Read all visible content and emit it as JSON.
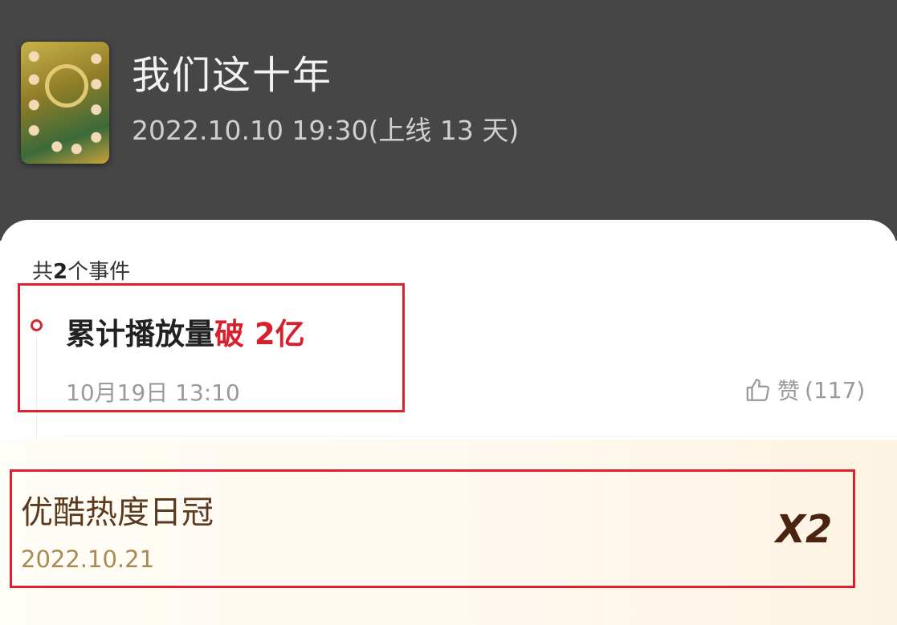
{
  "show": {
    "title": "我们这十年",
    "air_info": "2022.10.10 19:30(上线 13 天)"
  },
  "events_summary": {
    "prefix": "共",
    "count": "2",
    "suffix": "个事件"
  },
  "event": {
    "title_main": "累计播放量",
    "title_highlight": "破 2亿",
    "time": "10月19日 13:10",
    "like_label": "赞",
    "like_count": "(117)"
  },
  "award": {
    "title": "优酷热度日冠",
    "date": "2022.10.21",
    "multiplier": "X2"
  },
  "colors": {
    "header_bg": "#464646",
    "highlight_red": "#d81f2c",
    "annotation_box": "#e0202e",
    "award_text": "#5b3a1e"
  }
}
